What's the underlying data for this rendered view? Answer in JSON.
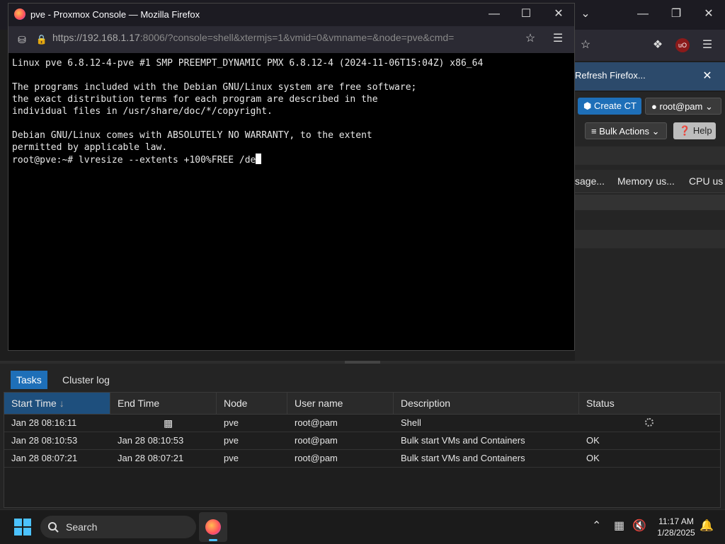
{
  "background_window": {
    "notification_text": "Refresh Firefox...",
    "toolbar": {
      "create_ct_label": "Create CT",
      "user_label": "root@pam",
      "bulk_actions_label": "Bulk Actions",
      "help_label": "Help"
    },
    "columns": [
      "sage...",
      "Memory us...",
      "CPU us"
    ]
  },
  "firefox_window": {
    "title": "pve - Proxmox Console — Mozilla Firefox",
    "url_host": "https://192.168.1.17",
    "url_rest": ":8006/?console=shell&xtermjs=1&vmid=0&vmname=&node=pve&cmd="
  },
  "terminal": {
    "lines": [
      "Linux pve 6.8.12-4-pve #1 SMP PREEMPT_DYNAMIC PMX 6.8.12-4 (2024-11-06T15:04Z) x86_64",
      "",
      "The programs included with the Debian GNU/Linux system are free software;",
      "the exact distribution terms for each program are described in the",
      "individual files in /usr/share/doc/*/copyright.",
      "",
      "Debian GNU/Linux comes with ABSOLUTELY NO WARRANTY, to the extent",
      "permitted by applicable law."
    ],
    "prompt": "root@pve:~# ",
    "command": "lvresize --extents +100%FREE /de"
  },
  "tasks_panel": {
    "tabs": [
      "Tasks",
      "Cluster log"
    ],
    "headers": [
      "Start Time",
      "End Time",
      "Node",
      "User name",
      "Description",
      "Status"
    ],
    "sort_indicator": "↓",
    "rows": [
      {
        "start": "Jan 28 08:16:11",
        "end": "",
        "node": "pve",
        "user": "root@pam",
        "description": "Shell",
        "status": ""
      },
      {
        "start": "Jan 28 08:10:53",
        "end": "Jan 28 08:10:53",
        "node": "pve",
        "user": "root@pam",
        "description": "Bulk start VMs and Containers",
        "status": "OK"
      },
      {
        "start": "Jan 28 08:07:21",
        "end": "Jan 28 08:07:21",
        "node": "pve",
        "user": "root@pam",
        "description": "Bulk start VMs and Containers",
        "status": "OK"
      }
    ]
  },
  "taskbar": {
    "search_label": "Search",
    "time": "11:17 AM",
    "date": "1/28/2025"
  },
  "colors": {
    "accent_blue": "#1e6fb8",
    "sorted_header": "#1e4f7d",
    "terminal_bg": "#000000",
    "firefox_frame": "#1c1b22"
  }
}
